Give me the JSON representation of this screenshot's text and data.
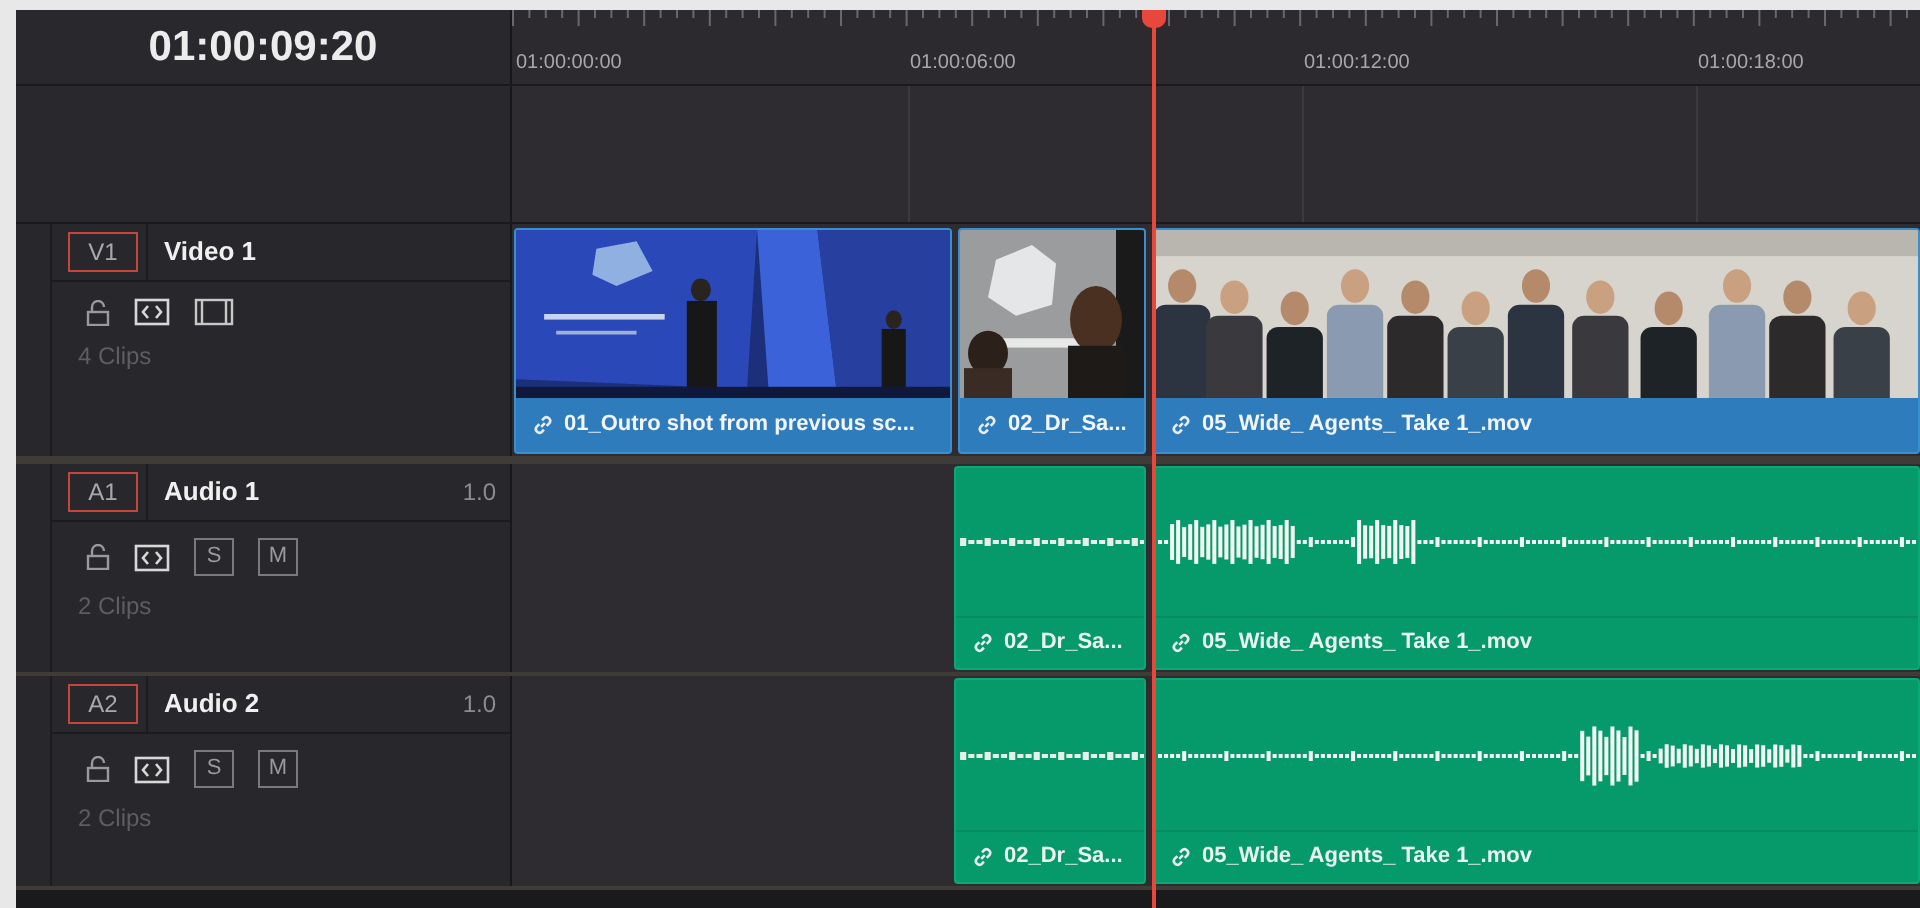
{
  "timecode": "01:00:09:20",
  "ruler": [
    "01:00:00:00",
    "01:00:06:00",
    "01:00:12:00",
    "01:00:18:00"
  ],
  "tracks": [
    {
      "kind": "video",
      "badge": "V1",
      "name": "Video 1",
      "locked": false,
      "clip_count": "4 Clips",
      "clips": [
        {
          "label": "01_Outro shot from previous sc..."
        },
        {
          "label": "02_Dr_Sa..."
        },
        {
          "label": "05_Wide_ Agents_ Take 1_.mov"
        }
      ]
    },
    {
      "kind": "audio",
      "badge": "A1",
      "name": "Audio 1",
      "volume": "1.0",
      "locked": false,
      "solo": "S",
      "mute": "M",
      "clip_count": "2 Clips",
      "clips": [
        {
          "label": "02_Dr_Sa..."
        },
        {
          "label": "05_Wide_ Agents_ Take 1_.mov"
        }
      ]
    },
    {
      "kind": "audio",
      "badge": "A2",
      "name": "Audio 2",
      "volume": "1.0",
      "locked": false,
      "solo": "S",
      "mute": "M",
      "clip_count": "2 Clips",
      "clips": [
        {
          "label": "02_Dr_Sa..."
        },
        {
          "label": "05_Wide_ Agents_ Take 1_.mov"
        }
      ]
    }
  ]
}
